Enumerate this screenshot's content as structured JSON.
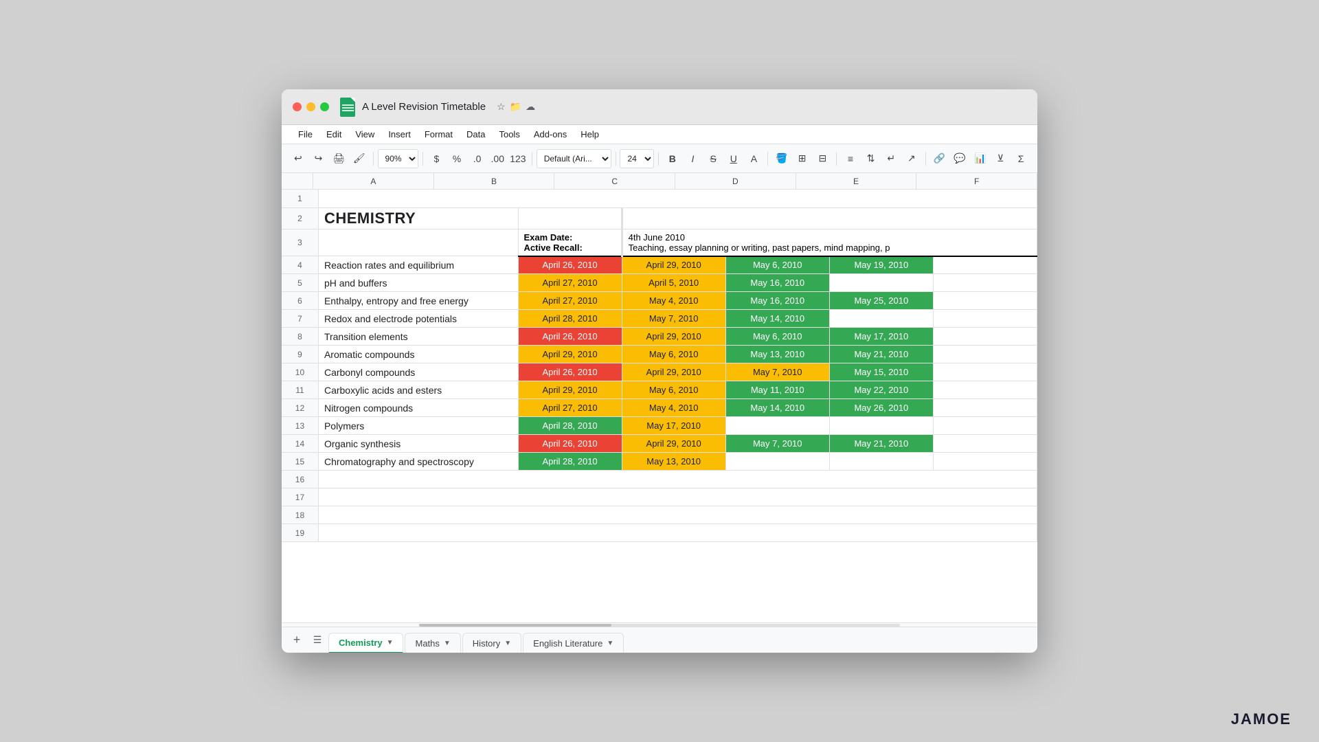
{
  "window": {
    "title": "A Level Revision Timetable"
  },
  "menubar": {
    "items": [
      "File",
      "Edit",
      "View",
      "Insert",
      "Format",
      "Data",
      "Tools",
      "Add-ons",
      "Help"
    ]
  },
  "toolbar": {
    "zoom": "90%",
    "font": "Default (Ari...)",
    "font_size": "24"
  },
  "spreadsheet": {
    "subject": "CHEMISTRY",
    "exam_date_label": "Exam Date:",
    "exam_date_value": "4th June 2010",
    "active_recall_label": "Active Recall:",
    "active_recall_value": "Teaching, essay planning or writing, past papers, mind mapping, p",
    "col_headers": [
      "A",
      "B",
      "C",
      "D",
      "E",
      "F"
    ],
    "rows": [
      {
        "num": 1,
        "cells": []
      },
      {
        "num": 2,
        "topic": "CHEMISTRY",
        "is_title": true
      },
      {
        "num": 3,
        "exam_info": true
      },
      {
        "num": 4,
        "topic": "Reaction rates and equilibrium",
        "dates": [
          "April 26, 2010",
          "April 29, 2010",
          "May 6, 2010",
          "May 19, 2010"
        ],
        "colors": [
          "red",
          "yellow",
          "green",
          "green"
        ]
      },
      {
        "num": 5,
        "topic": "pH and buffers",
        "dates": [
          "April 27, 2010",
          "April 5, 2010",
          "May 16, 2010",
          ""
        ],
        "colors": [
          "yellow",
          "yellow",
          "green",
          ""
        ]
      },
      {
        "num": 6,
        "topic": "Enthalpy, entropy and free energy",
        "dates": [
          "April 27, 2010",
          "May 4, 2010",
          "May 16, 2010",
          "May 25, 2010"
        ],
        "colors": [
          "yellow",
          "yellow",
          "green",
          "green"
        ]
      },
      {
        "num": 7,
        "topic": "Redox and electrode potentials",
        "dates": [
          "April 28, 2010",
          "May 7, 2010",
          "May 14, 2010",
          ""
        ],
        "colors": [
          "yellow",
          "yellow",
          "green",
          ""
        ]
      },
      {
        "num": 8,
        "topic": "Transition elements",
        "dates": [
          "April 26, 2010",
          "April 29, 2010",
          "May 6, 2010",
          "May 17, 2010"
        ],
        "colors": [
          "red",
          "yellow",
          "green",
          "green"
        ]
      },
      {
        "num": 9,
        "topic": "Aromatic compounds",
        "dates": [
          "April 29, 2010",
          "May 6, 2010",
          "May 13, 2010",
          "May 21, 2010"
        ],
        "colors": [
          "yellow",
          "yellow",
          "green",
          "green"
        ]
      },
      {
        "num": 10,
        "topic": "Carbonyl compounds",
        "dates": [
          "April 26, 2010",
          "April 29, 2010",
          "May 7, 2010",
          "May 15, 2010"
        ],
        "colors": [
          "red",
          "yellow",
          "yellow",
          "green"
        ]
      },
      {
        "num": 11,
        "topic": "Carboxylic acids and esters",
        "dates": [
          "April 29, 2010",
          "May 6, 2010",
          "May 11, 2010",
          "May 22, 2010"
        ],
        "colors": [
          "yellow",
          "yellow",
          "green",
          "green"
        ]
      },
      {
        "num": 12,
        "topic": "Nitrogen compounds",
        "dates": [
          "April 27, 2010",
          "May 4, 2010",
          "May 14, 2010",
          "May 26, 2010"
        ],
        "colors": [
          "yellow",
          "yellow",
          "green",
          "green"
        ]
      },
      {
        "num": 13,
        "topic": "Polymers",
        "dates": [
          "April 28, 2010",
          "May 17, 2010",
          "",
          ""
        ],
        "colors": [
          "green",
          "yellow",
          "",
          ""
        ]
      },
      {
        "num": 14,
        "topic": "Organic synthesis",
        "dates": [
          "April 26, 2010",
          "April 29, 2010",
          "May 7, 2010",
          "May 21, 2010"
        ],
        "colors": [
          "red",
          "yellow",
          "green",
          "green"
        ]
      },
      {
        "num": 15,
        "topic": "Chromatography and spectroscopy",
        "dates": [
          "April 28, 2010",
          "May 13, 2010",
          "",
          ""
        ],
        "colors": [
          "green",
          "yellow",
          "",
          ""
        ]
      },
      {
        "num": 16,
        "cells": []
      },
      {
        "num": 17,
        "cells": []
      },
      {
        "num": 18,
        "cells": []
      },
      {
        "num": 19,
        "cells": []
      }
    ]
  },
  "sheet_tabs": [
    {
      "label": "Chemistry",
      "active": true
    },
    {
      "label": "Maths",
      "active": false
    },
    {
      "label": "History",
      "active": false
    },
    {
      "label": "English Literature",
      "active": false
    }
  ],
  "watermark": "JAMOE"
}
